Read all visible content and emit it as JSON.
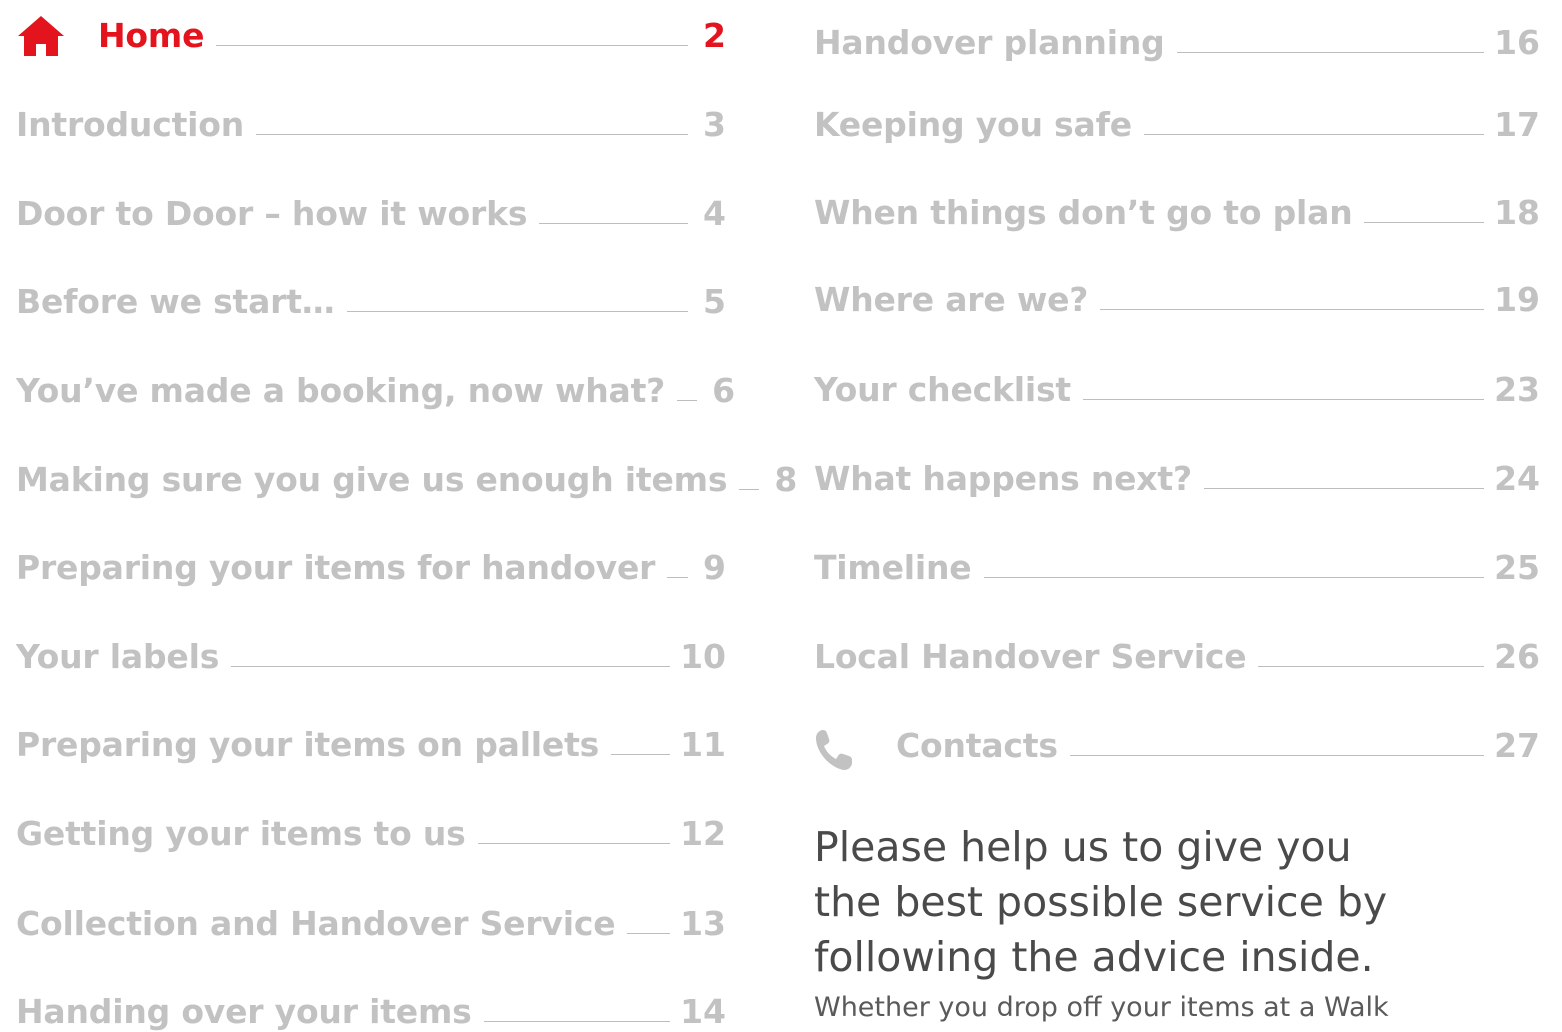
{
  "toc_left": [
    {
      "label": "Home",
      "page": "2"
    },
    {
      "label": "Introduction",
      "page": "3"
    },
    {
      "label": "Door to Door – how it works",
      "page": "4"
    },
    {
      "label": "Before we start…",
      "page": "5"
    },
    {
      "label": "You’ve made a booking, now what?",
      "page": "6"
    },
    {
      "label": "Making sure you give us enough items",
      "page": "8"
    },
    {
      "label": "Preparing your items for handover",
      "page": "9"
    },
    {
      "label": "Your labels",
      "page": "10"
    },
    {
      "label": "Preparing your items on pallets",
      "page": "11"
    },
    {
      "label": "Getting your items to us",
      "page": "12"
    },
    {
      "label": "Collection and Handover Service",
      "page": "13"
    },
    {
      "label": "Handing over your items",
      "page": "14"
    }
  ],
  "toc_right": [
    {
      "label": "Handover planning",
      "page": "16"
    },
    {
      "label": "Keeping you safe",
      "page": "17"
    },
    {
      "label": "When things don’t go to plan",
      "page": "18"
    },
    {
      "label": "Where are we?",
      "page": "19"
    },
    {
      "label": "Your checklist",
      "page": "23"
    },
    {
      "label": "What happens next?",
      "page": "24"
    },
    {
      "label": "Timeline",
      "page": "25"
    },
    {
      "label": "Local Handover Service",
      "page": "26"
    },
    {
      "label": "Contacts",
      "page": "27"
    }
  ],
  "icons": {
    "home": "home-icon",
    "contacts": "phone-icon"
  },
  "colors": {
    "active": "#e3141d",
    "inactive": "#c2c2c2",
    "leader": "#bdbdbd",
    "text": "#4a4a4a"
  },
  "intro": {
    "heading_line1": "Please help us to give you",
    "heading_line2": "the best possible service by",
    "heading_line3": "following the advice inside.",
    "body": "Whether you drop off your items at a Walk"
  }
}
